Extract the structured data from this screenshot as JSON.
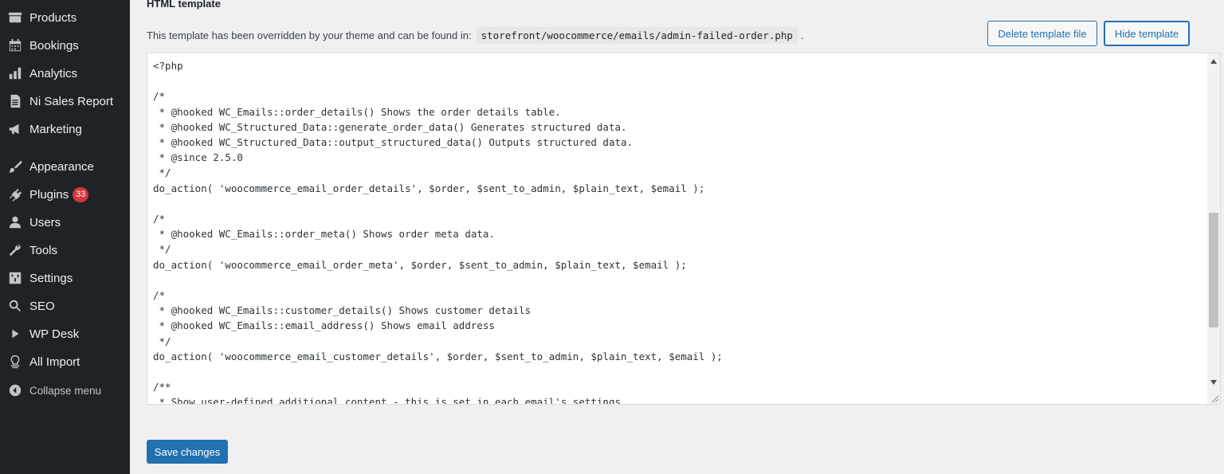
{
  "sidebar": {
    "items": [
      {
        "label": "Products",
        "icon": "products-icon"
      },
      {
        "label": "Bookings",
        "icon": "calendar-icon"
      },
      {
        "label": "Analytics",
        "icon": "bar-chart-icon"
      },
      {
        "label": "Ni Sales Report",
        "icon": "document-icon"
      },
      {
        "label": "Marketing",
        "icon": "megaphone-icon"
      },
      {
        "label": "Appearance",
        "icon": "paintbrush-icon"
      },
      {
        "label": "Plugins",
        "icon": "plugin-icon",
        "badge": "33"
      },
      {
        "label": "Users",
        "icon": "user-icon"
      },
      {
        "label": "Tools",
        "icon": "wrench-icon"
      },
      {
        "label": "Settings",
        "icon": "settings-icon"
      },
      {
        "label": "SEO",
        "icon": "search-icon"
      },
      {
        "label": "WP Desk",
        "icon": "play-icon"
      },
      {
        "label": "All Import",
        "icon": "import-icon"
      }
    ],
    "collapse_label": "Collapse menu"
  },
  "main": {
    "heading": "HTML template",
    "description": "This template has been overridden by your theme and can be found in:",
    "template_path": "storefront/woocommerce/emails/admin-failed-order.php",
    "description_end": ".",
    "delete_button": "Delete template file",
    "hide_button": "Hide template",
    "save_button": "Save changes",
    "code": "<?php\n\n/*\n * @hooked WC_Emails::order_details() Shows the order details table.\n * @hooked WC_Structured_Data::generate_order_data() Generates structured data.\n * @hooked WC_Structured_Data::output_structured_data() Outputs structured data.\n * @since 2.5.0\n */\ndo_action( 'woocommerce_email_order_details', $order, $sent_to_admin, $plain_text, $email );\n\n/*\n * @hooked WC_Emails::order_meta() Shows order meta data.\n */\ndo_action( 'woocommerce_email_order_meta', $order, $sent_to_admin, $plain_text, $email );\n\n/*\n * @hooked WC_Emails::customer_details() Shows customer details\n * @hooked WC_Emails::email_address() Shows email address\n */\ndo_action( 'woocommerce_email_customer_details', $order, $sent_to_admin, $plain_text, $email );\n\n/**\n * Show user-defined additional content - this is set in each email's settings."
  },
  "colors": {
    "sidebar_bg": "#1d2327",
    "accent": "#2271b1",
    "badge": "#d63638",
    "page_bg": "#f0f0f1"
  }
}
